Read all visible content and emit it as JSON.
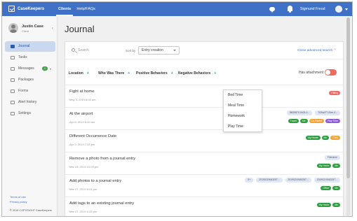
{
  "app": {
    "logo_text": "CaseKeepers"
  },
  "topnav": {
    "items": [
      "Clients",
      "Help/FAQs"
    ]
  },
  "user": {
    "name": "Sigmund Freud"
  },
  "sidebar": {
    "profile": {
      "name": "Justin Case",
      "role": "Client"
    },
    "items": [
      {
        "label": "Journal"
      },
      {
        "label": "Tasks"
      },
      {
        "label": "Messages",
        "badge": "0"
      },
      {
        "label": "Packages"
      },
      {
        "label": "Forms"
      },
      {
        "label": "Alert history"
      },
      {
        "label": "Settings"
      }
    ],
    "footer_links": [
      "Terms of use",
      "Privacy policy"
    ],
    "copyright": "© 2019 COPYRIGHT CaseKeepers"
  },
  "page": {
    "title": "Journal"
  },
  "search": {
    "placeholder": "Search"
  },
  "sort": {
    "label": "Sort by",
    "value": "Entry creation"
  },
  "advanced_link": "Close advanced search",
  "filters": [
    "Location",
    "Who Was There",
    "Positive Behaviors",
    "Negative Behaviors"
  ],
  "attachment": {
    "label": "Has attachment",
    "on": true
  },
  "dropdown": {
    "items": [
      "Bed Time",
      "Meal Time",
      "Homework",
      "Play Time"
    ]
  },
  "colors": {
    "brand": "#3f72c6",
    "hitting": "#ef6b62",
    "travel": "#2e9e3e",
    "me": "#2e9e3e",
    "co_parent": "#f2a33a",
    "play_time": "#8e5bd8",
    "my_home": "#2e9e3e",
    "child": "#f2a33a",
    "office": "#2e9e3e"
  },
  "entries": [
    {
      "title": "Fight at home",
      "date": "May 3, 2019 8:09 am",
      "files": [],
      "tags": [
        {
          "label": "Hitting",
          "color": "#ef6b62"
        }
      ]
    },
    {
      "title": "At the airport",
      "date": "Apr 8, 2019 6:00 am",
      "files": [
        "8f625870-9c05-4...",
        "7f26a077-f0ee-4..."
      ],
      "tags": [
        {
          "label": "Travel",
          "color": "#2e9e3e"
        },
        {
          "label": "Me",
          "color": "#2e9e3e"
        },
        {
          "label": "Co-Parent",
          "color": "#f2a33a"
        },
        {
          "label": "Play Time",
          "color": "#8e5bd8"
        }
      ]
    },
    {
      "title": "Different Occurrence Date",
      "date": "Apr 3, 2019 7:28 pm",
      "files": [],
      "tags": [
        {
          "label": "My Home",
          "color": "#2e9e3e"
        },
        {
          "label": "Me",
          "color": "#2e9e3e"
        },
        {
          "label": "Child",
          "color": "#f2a33a"
        }
      ]
    },
    {
      "title": "Remove a photo from a journal entry",
      "date": "Mar 28, 2019 10:00 pm",
      "files": [
        "Filename"
      ],
      "tags": [
        {
          "label": "My Home",
          "color": "#2e9e3e"
        },
        {
          "label": "Me",
          "color": "#2e9e3e"
        }
      ]
    },
    {
      "title": "Add photos to a journal entry",
      "date": "Mar 27, 2019 8:04 pm",
      "files": [
        "5+",
        "20190219063257...",
        "20190219063257...",
        "20190219063257..."
      ],
      "tags": [
        {
          "label": "Office",
          "color": "#2e9e3e"
        },
        {
          "label": "Me",
          "color": "#2e9e3e"
        }
      ]
    },
    {
      "title": "Add tags to an existing journal entry",
      "date": "Mar 27, 2019 6:33 pm",
      "files": [],
      "tags": [
        {
          "label": "My Home",
          "color": "#2e9e3e"
        },
        {
          "label": "Me",
          "color": "#2e9e3e"
        }
      ]
    }
  ]
}
